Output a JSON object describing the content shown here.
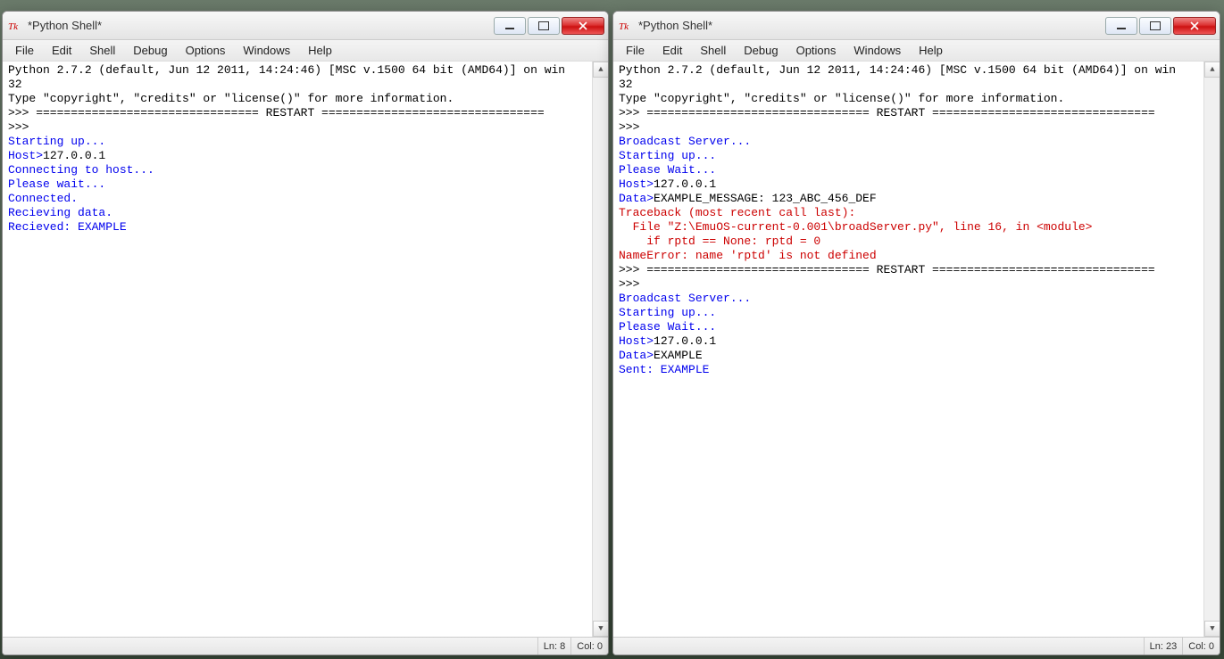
{
  "windows": [
    {
      "id": "left",
      "title": "*Python Shell*",
      "menus": [
        "File",
        "Edit",
        "Shell",
        "Debug",
        "Options",
        "Windows",
        "Help"
      ],
      "status": {
        "ln": "Ln: 8",
        "col": "Col: 0"
      }
    },
    {
      "id": "right",
      "title": "*Python Shell*",
      "menus": [
        "File",
        "Edit",
        "Shell",
        "Debug",
        "Options",
        "Windows",
        "Help"
      ],
      "status": {
        "ln": "Ln: 23",
        "col": "Col: 0"
      }
    }
  ],
  "left_lines": [
    {
      "cls": "",
      "text": "Python 2.7.2 (default, Jun 12 2011, 14:24:46) [MSC v.1500 64 bit (AMD64)] on win"
    },
    {
      "cls": "",
      "text": "32"
    },
    {
      "cls": "",
      "text": "Type \"copyright\", \"credits\" or \"license()\" for more information."
    },
    {
      "cls": "",
      "text": ">>> ================================ RESTART ================================"
    },
    {
      "cls": "",
      "text": ">>> "
    },
    {
      "cls": "blue",
      "text": "Starting up..."
    },
    {
      "cls": "blue",
      "text": "Host>"
    },
    {
      "cls": "",
      "text": "127.0.0.1",
      "inline": true
    },
    {
      "cls": "blue",
      "text": "Connecting to host..."
    },
    {
      "cls": "blue",
      "text": "Please wait..."
    },
    {
      "cls": "blue",
      "text": "Connected."
    },
    {
      "cls": "blue",
      "text": "Recieving data."
    },
    {
      "cls": "blue",
      "text": "Recieved: EXAMPLE"
    }
  ],
  "right_lines": [
    {
      "cls": "",
      "text": "Python 2.7.2 (default, Jun 12 2011, 14:24:46) [MSC v.1500 64 bit (AMD64)] on win"
    },
    {
      "cls": "",
      "text": "32"
    },
    {
      "cls": "",
      "text": "Type \"copyright\", \"credits\" or \"license()\" for more information."
    },
    {
      "cls": "",
      "text": ">>> ================================ RESTART ================================"
    },
    {
      "cls": "",
      "text": ">>> "
    },
    {
      "cls": "blue",
      "text": "Broadcast Server..."
    },
    {
      "cls": "blue",
      "text": "Starting up..."
    },
    {
      "cls": "blue",
      "text": "Please Wait..."
    },
    {
      "cls": "blue",
      "text": "Host>"
    },
    {
      "cls": "",
      "text": "127.0.0.1",
      "inline": true
    },
    {
      "cls": "blue",
      "text": "Data>"
    },
    {
      "cls": "",
      "text": "EXAMPLE_MESSAGE: 123_ABC_456_DEF",
      "inline": true
    },
    {
      "cls": "",
      "text": ""
    },
    {
      "cls": "red",
      "text": "Traceback (most recent call last):"
    },
    {
      "cls": "red",
      "text": "  File \"Z:\\EmuOS-current-0.001\\broadServer.py\", line 16, in <module>"
    },
    {
      "cls": "red",
      "text": "    if rptd == None: rptd = 0"
    },
    {
      "cls": "red",
      "text": "NameError: name 'rptd' is not defined"
    },
    {
      "cls": "",
      "text": ">>> ================================ RESTART ================================"
    },
    {
      "cls": "",
      "text": ">>> "
    },
    {
      "cls": "blue",
      "text": "Broadcast Server..."
    },
    {
      "cls": "blue",
      "text": "Starting up..."
    },
    {
      "cls": "blue",
      "text": "Please Wait..."
    },
    {
      "cls": "blue",
      "text": "Host>"
    },
    {
      "cls": "",
      "text": "127.0.0.1",
      "inline": true
    },
    {
      "cls": "blue",
      "text": "Data>"
    },
    {
      "cls": "",
      "text": "EXAMPLE",
      "inline": true
    },
    {
      "cls": "blue",
      "text": "Sent: EXAMPLE"
    }
  ]
}
